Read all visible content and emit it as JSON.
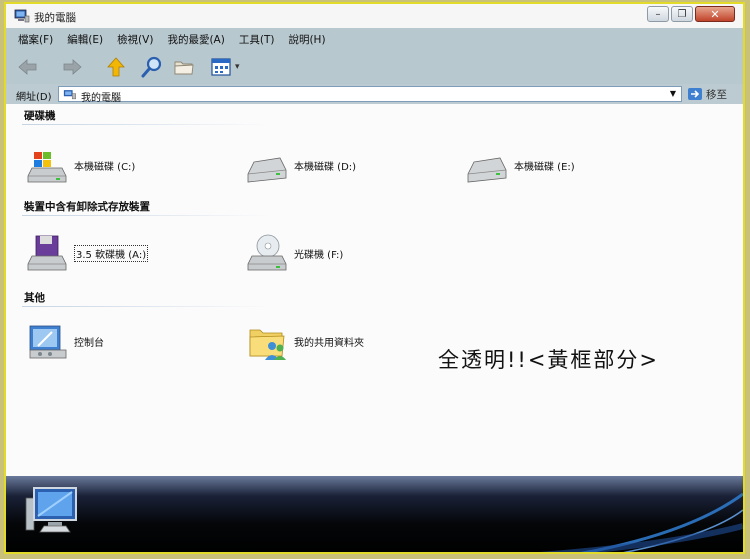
{
  "window": {
    "title": "我的電腦",
    "minimize_glyph": "–",
    "restore_glyph": "❐",
    "close_glyph": "✕"
  },
  "menubar": {
    "items": [
      "檔案(F)",
      "編輯(E)",
      "檢視(V)",
      "我的最愛(A)",
      "工具(T)",
      "說明(H)"
    ]
  },
  "toolbar": {
    "icons": [
      "back-arrow-icon",
      "forward-arrow-icon",
      "up-folder-icon",
      "search-icon",
      "folders-icon",
      "views-icon"
    ],
    "views_dropdown": "▾"
  },
  "address": {
    "label": "網址(D)",
    "value": "我的電腦",
    "dropdown": "▼",
    "go_label": "移至"
  },
  "groups": [
    {
      "title": "硬碟機",
      "items": [
        {
          "label": "本機磁碟 (C:)",
          "icon": "windows-drive-icon"
        },
        {
          "label": "本機磁碟 (D:)",
          "icon": "hard-drive-icon"
        },
        {
          "label": "本機磁碟 (E:)",
          "icon": "hard-drive-icon"
        }
      ]
    },
    {
      "title": "裝置中含有卸除式存放裝置",
      "items": [
        {
          "label": "3.5 軟碟機 (A:)",
          "icon": "floppy-drive-icon"
        },
        {
          "label": "光碟機 (F:)",
          "icon": "cd-drive-icon"
        }
      ]
    },
    {
      "title": "其他",
      "items": [
        {
          "label": "控制台",
          "icon": "control-panel-icon"
        },
        {
          "label": "我的共用資料夾",
          "icon": "shared-folder-icon"
        }
      ]
    }
  ],
  "overlay_note": "全透明!!<黃框部分>",
  "colors": {
    "menubar_bg": "#b8c8cf",
    "highlight_frame": "#e3db2a",
    "bottom_panel": "#000000",
    "accent_blue": "#2f78c8"
  }
}
